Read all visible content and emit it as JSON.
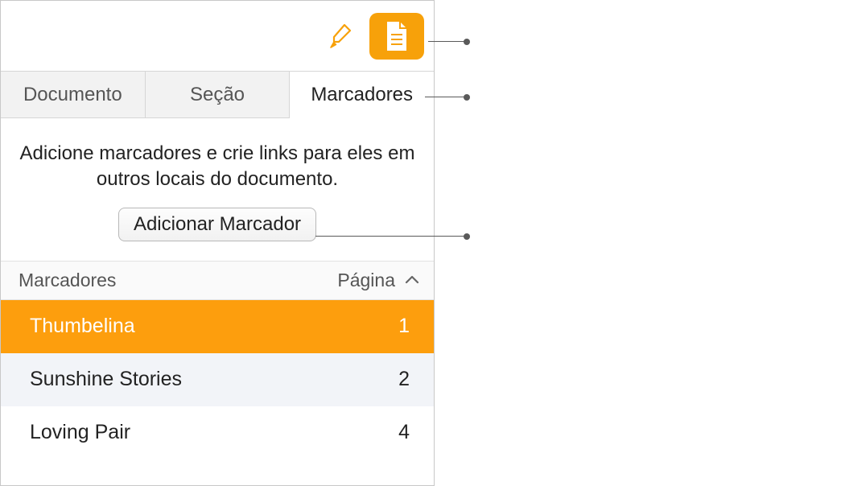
{
  "toolbar": {
    "brush_icon": "brush-icon",
    "doc_icon": "document-icon"
  },
  "tabs": [
    {
      "label": "Documento",
      "active": false
    },
    {
      "label": "Seção",
      "active": false
    },
    {
      "label": "Marcadores",
      "active": true
    }
  ],
  "description": "Adicione marcadores e crie links para eles em outros locais do documento.",
  "add_button_label": "Adicionar Marcador",
  "list_header": {
    "name_col": "Marcadores",
    "page_col": "Página"
  },
  "bookmarks": [
    {
      "name": "Thumbelina",
      "page": "1",
      "selected": true
    },
    {
      "name": "Sunshine Stories",
      "page": "2",
      "selected": false
    },
    {
      "name": "Loving Pair",
      "page": "4",
      "selected": false
    }
  ],
  "colors": {
    "accent": "#f7a10a",
    "selection": "#fd9e0d"
  }
}
